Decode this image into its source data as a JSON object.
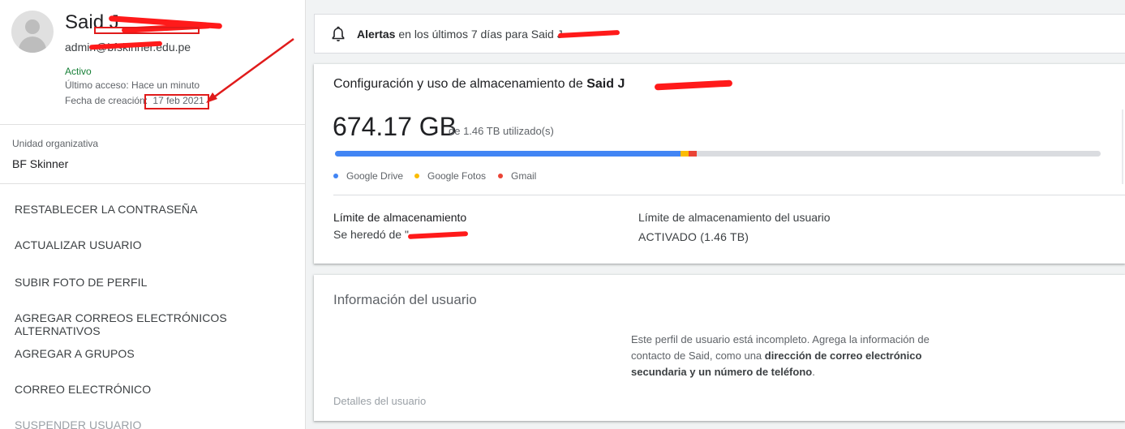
{
  "user": {
    "name": "Said J",
    "email": "admin@bfskinner.edu.pe",
    "status": "Activo",
    "last_access": "Último acceso: Hace un minuto",
    "created_label": "Fecha de creación:",
    "created_date": "17 feb 2021"
  },
  "org_unit": {
    "label": "Unidad organizativa",
    "value": "BF Skinner"
  },
  "actions": [
    {
      "label": "RESTABLECER LA CONTRASEÑA"
    },
    {
      "label": "ACTUALIZAR USUARIO"
    },
    {
      "label": "SUBIR FOTO DE PERFIL"
    },
    {
      "label": "AGREGAR CORREOS ELECTRÓNICOS ALTERNATIVOS"
    },
    {
      "label": "AGREGAR A GRUPOS"
    },
    {
      "label": "CORREO ELECTRÓNICO"
    },
    {
      "label": "SUSPENDER USUARIO"
    }
  ],
  "alerts": {
    "strong": "Alertas",
    "text": "en los últimos 7 días para Said J"
  },
  "storage": {
    "title_prefix": "Configuración y uso de almacenamiento de",
    "title_name": "Said J",
    "used": "674.17 GB",
    "of_total": "de 1.46 TB utilizado(s)",
    "segments": [
      {
        "name": "Google Drive",
        "fraction": 0.451,
        "color": "#4285f4"
      },
      {
        "name": "Google Fotos",
        "fraction": 0.011,
        "color": "#fbbc04"
      },
      {
        "name": "Gmail",
        "fraction": 0.011,
        "color": "#ea4335"
      }
    ],
    "limit_label": "Límite de almacenamiento",
    "limit_inherit": "Se heredó de \"",
    "user_limit_label": "Límite de almacenamiento del usuario",
    "user_limit_value": "ACTIVADO (1.46 TB)"
  },
  "info": {
    "title": "Información del usuario",
    "msg_1": "Este perfil de usuario está incompleto. Agrega la información de contacto de Said, como una ",
    "msg_bold": "dirección de correo electrónico secundaria y un número de teléfono",
    "msg_end": ".",
    "details": "Detalles del usuario"
  },
  "colors": {
    "active_green": "#188038",
    "drive_blue": "#4285f4",
    "photos_yellow": "#fbbc04",
    "gmail_red": "#ea4335",
    "annotation_red": "#e01b1b"
  },
  "icons": {
    "bell": "bell-icon",
    "avatar": "avatar-placeholder"
  }
}
